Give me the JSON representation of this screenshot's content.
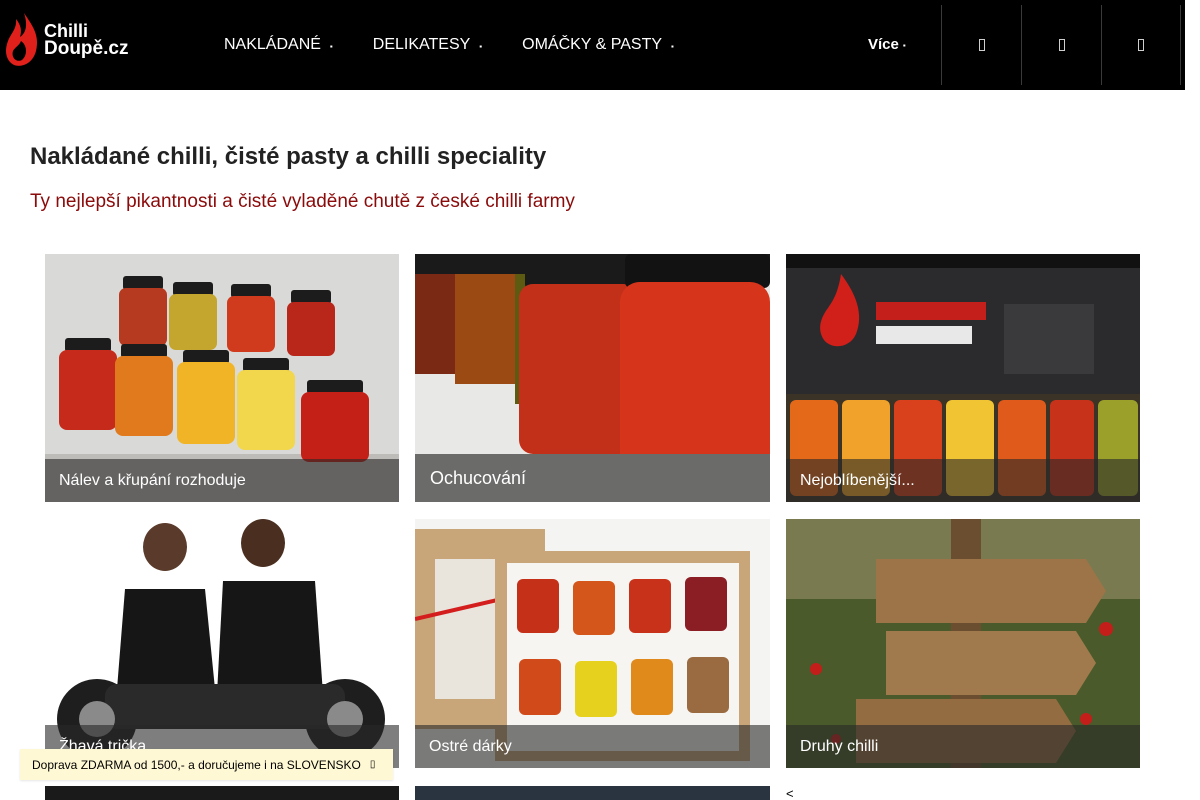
{
  "logo": {
    "line1": "Chilli",
    "line2": "Doupě.cz"
  },
  "nav": {
    "items": [
      {
        "label": "NAKLÁDANÉ"
      },
      {
        "label": "DELIKATESY"
      },
      {
        "label": "OMÁČKY & PASTY"
      }
    ],
    "more_label": "Více"
  },
  "header_icons": [
    "search-icon",
    "account-icon",
    "cart-icon"
  ],
  "page": {
    "title": "Nakládané chilli, čisté pasty a chilli speciality",
    "subtitle": "Ty nejlepší pikantnosti a čisté vyladěné chutě z české chilli farmy"
  },
  "tiles": [
    {
      "label": "Nálev a křupání rozhoduje"
    },
    {
      "label": "Ochucování"
    },
    {
      "label": "Nejoblíbenější..."
    },
    {
      "label": "Žhavá trička"
    },
    {
      "label": "Ostré dárky"
    },
    {
      "label": "Druhy chilli"
    }
  ],
  "shipping": {
    "text": "Doprava ZDARMA od 1500,- a doručujeme i na SLOVENSKO"
  },
  "carousel": {
    "prev": "<"
  },
  "colors": {
    "header_bg": "#000000",
    "accent_red": "#8b0a0a",
    "shipping_bg": "#fff8d4"
  }
}
